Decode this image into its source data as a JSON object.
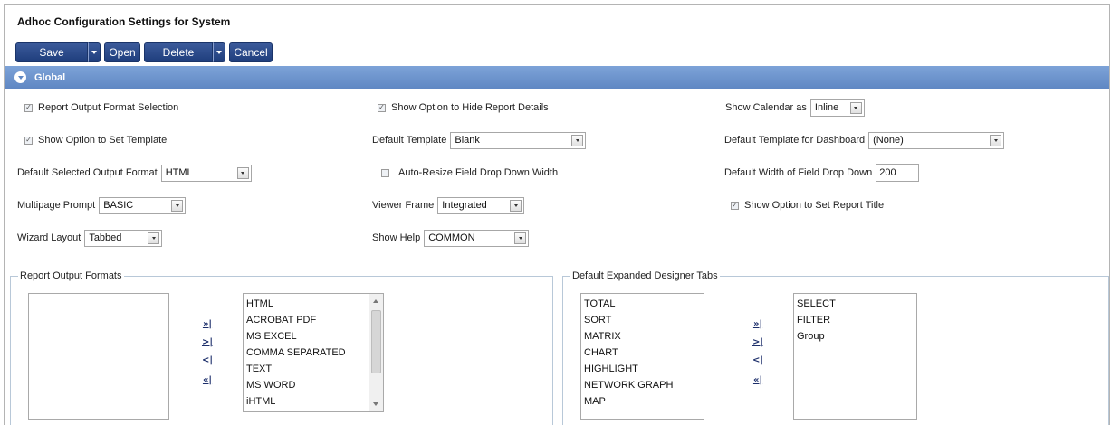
{
  "page_title": "Adhoc Configuration Settings for System",
  "toolbar": {
    "save": "Save",
    "open": "Open",
    "delete": "Delete",
    "cancel": "Cancel"
  },
  "section": {
    "title": "Global"
  },
  "settings": {
    "report_output_format_selection": {
      "label": "Report Output Format Selection",
      "checked": true
    },
    "show_option_hide_details": {
      "label": "Show Option to Hide Report Details",
      "checked": true
    },
    "show_calendar_as": {
      "label": "Show Calendar as",
      "value": "Inline"
    },
    "show_option_set_template": {
      "label": "Show Option to Set Template",
      "checked": true
    },
    "default_template": {
      "label": "Default Template",
      "value": "Blank"
    },
    "default_template_dashboard": {
      "label": "Default Template for Dashboard",
      "value": "(None)"
    },
    "default_selected_output_format": {
      "label": "Default Selected Output Format",
      "value": "HTML"
    },
    "auto_resize": {
      "label": "Auto-Resize Field Drop Down Width",
      "checked": false
    },
    "default_width_drop_down": {
      "label": "Default Width of Field Drop Down",
      "value": "200"
    },
    "multipage_prompt": {
      "label": "Multipage Prompt",
      "value": "BASIC"
    },
    "viewer_frame": {
      "label": "Viewer Frame",
      "value": "Integrated"
    },
    "show_option_report_title": {
      "label": "Show Option to Set Report Title",
      "checked": true
    },
    "wizard_layout": {
      "label": "Wizard Layout",
      "value": "Tabbed"
    },
    "show_help": {
      "label": "Show Help",
      "value": "COMMON"
    }
  },
  "report_output_formats": {
    "legend": "Report Output Formats",
    "available": [],
    "selected": [
      "HTML",
      "ACROBAT PDF",
      "MS EXCEL",
      "COMMA SEPARATED",
      "TEXT",
      "MS WORD",
      "iHTML"
    ]
  },
  "designer_tabs": {
    "legend": "Default Expanded Designer Tabs",
    "available": [
      "TOTAL",
      "SORT",
      "MATRIX",
      "CHART",
      "HIGHLIGHT",
      "NETWORK GRAPH",
      "MAP"
    ],
    "selected": [
      "SELECT",
      "FILTER",
      "Group"
    ]
  },
  "move_buttons": {
    "add_all": "»|",
    "add": ">|",
    "remove": "<|",
    "remove_all": "«|"
  }
}
